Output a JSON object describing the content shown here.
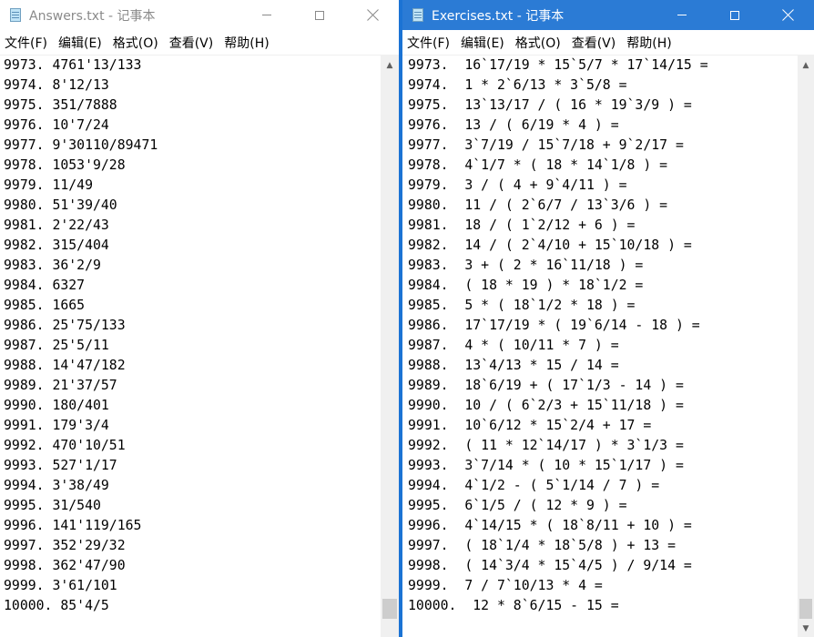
{
  "answers_window": {
    "title": "Answers.txt - 记事本",
    "menu": [
      "文件(F)",
      "编辑(E)",
      "格式(O)",
      "查看(V)",
      "帮助(H)"
    ],
    "lines": [
      "9973. 4761'13/133",
      "9974. 8'12/13",
      "9975. 351/7888",
      "9976. 10'7/24",
      "9977. 9'30110/89471",
      "9978. 1053'9/28",
      "9979. 11/49",
      "9980. 51'39/40",
      "9981. 2'22/43",
      "9982. 315/404",
      "9983. 36'2/9",
      "9984. 6327",
      "9985. 1665",
      "9986. 25'75/133",
      "9987. 25'5/11",
      "9988. 14'47/182",
      "9989. 21'37/57",
      "9990. 180/401",
      "9991. 179'3/4",
      "9992. 470'10/51",
      "9993. 527'1/17",
      "9994. 3'38/49",
      "9995. 31/540",
      "9996. 141'119/165",
      "9997. 352'29/32",
      "9998. 362'47/90",
      "9999. 3'61/101",
      "10000. 85'4/5"
    ]
  },
  "exercises_window": {
    "title": "Exercises.txt - 记事本",
    "menu": [
      "文件(F)",
      "编辑(E)",
      "格式(O)",
      "查看(V)",
      "帮助(H)"
    ],
    "lines": [
      "9973.  16`17/19 * 15`5/7 * 17`14/15 =",
      "9974.  1 * 2`6/13 * 3`5/8 =",
      "9975.  13`13/17 / ( 16 * 19`3/9 ) =",
      "9976.  13 / ( 6/19 * 4 ) =",
      "9977.  3`7/19 / 15`7/18 + 9`2/17 =",
      "9978.  4`1/7 * ( 18 * 14`1/8 ) =",
      "9979.  3 / ( 4 + 9`4/11 ) =",
      "9980.  11 / ( 2`6/7 / 13`3/6 ) =",
      "9981.  18 / ( 1`2/12 + 6 ) =",
      "9982.  14 / ( 2`4/10 + 15`10/18 ) =",
      "9983.  3 + ( 2 * 16`11/18 ) =",
      "9984.  ( 18 * 19 ) * 18`1/2 =",
      "9985.  5 * ( 18`1/2 * 18 ) =",
      "9986.  17`17/19 * ( 19`6/14 - 18 ) =",
      "9987.  4 * ( 10/11 * 7 ) =",
      "9988.  13`4/13 * 15 / 14 =",
      "9989.  18`6/19 + ( 17`1/3 - 14 ) =",
      "9990.  10 / ( 6`2/3 + 15`11/18 ) =",
      "9991.  10`6/12 * 15`2/4 + 17 =",
      "9992.  ( 11 * 12`14/17 ) * 3`1/3 =",
      "9993.  3`7/14 * ( 10 * 15`1/17 ) =",
      "9994.  4`1/2 - ( 5`1/14 / 7 ) =",
      "9995.  6`1/5 / ( 12 * 9 ) =",
      "9996.  4`14/15 * ( 18`8/11 + 10 ) =",
      "9997.  ( 18`1/4 * 18`5/8 ) + 13 =",
      "9998.  ( 14`3/4 * 15`4/5 ) / 9/14 =",
      "9999.  7 / 7`10/13 * 4 =",
      "10000.  12 * 8`6/15 - 15 ="
    ]
  },
  "icons": {
    "app": "notepad-icon",
    "minimize": "minimize-icon",
    "maximize": "maximize-icon",
    "close": "close-icon"
  },
  "colors": {
    "active_titlebar": "#2b7bd5",
    "window_divider": "#1b73d4"
  }
}
